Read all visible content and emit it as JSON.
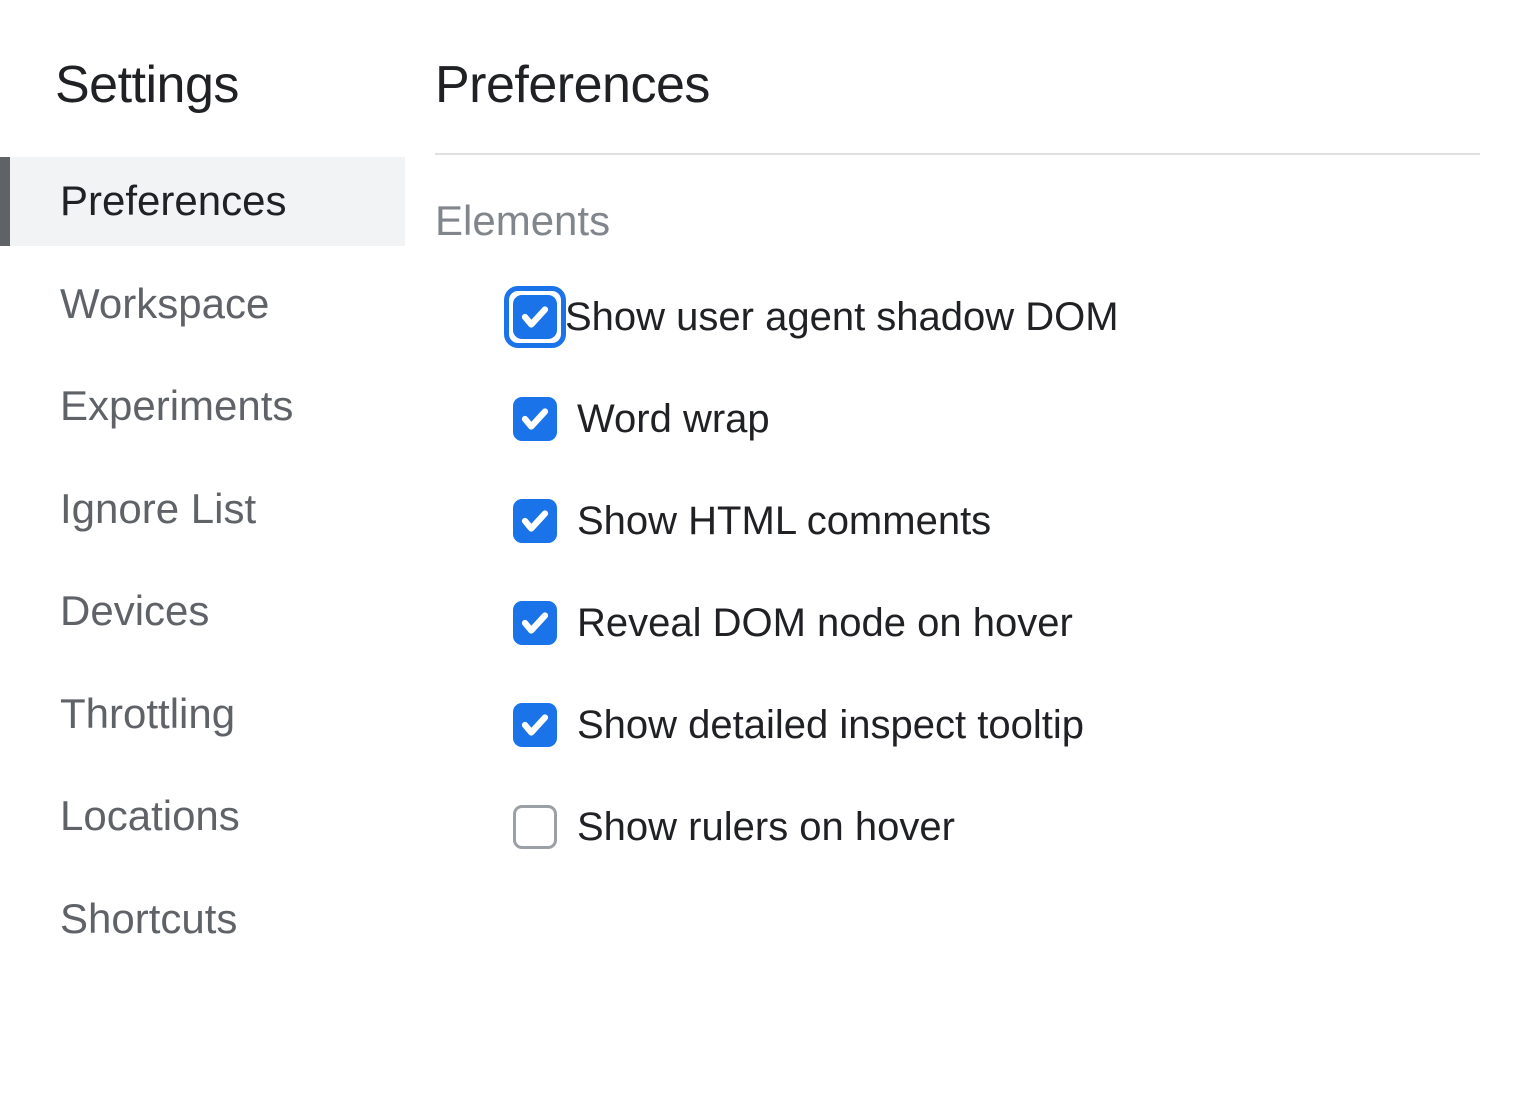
{
  "sidebar": {
    "title": "Settings",
    "items": [
      {
        "label": "Preferences",
        "selected": true
      },
      {
        "label": "Workspace",
        "selected": false
      },
      {
        "label": "Experiments",
        "selected": false
      },
      {
        "label": "Ignore List",
        "selected": false
      },
      {
        "label": "Devices",
        "selected": false
      },
      {
        "label": "Throttling",
        "selected": false
      },
      {
        "label": "Locations",
        "selected": false
      },
      {
        "label": "Shortcuts",
        "selected": false
      }
    ]
  },
  "main": {
    "title": "Preferences",
    "section_title": "Elements",
    "options": [
      {
        "label": "Show user agent shadow DOM",
        "checked": true,
        "focused": true
      },
      {
        "label": "Word wrap",
        "checked": true,
        "focused": false
      },
      {
        "label": "Show HTML comments",
        "checked": true,
        "focused": false
      },
      {
        "label": "Reveal DOM node on hover",
        "checked": true,
        "focused": false
      },
      {
        "label": "Show detailed inspect tooltip",
        "checked": true,
        "focused": false
      },
      {
        "label": "Show rulers on hover",
        "checked": false,
        "focused": false
      }
    ]
  },
  "colors": {
    "accent": "#1a73e8",
    "text_primary": "#202124",
    "text_secondary": "#5f6368",
    "text_muted": "#80868b",
    "selected_bg": "#f1f3f4"
  }
}
